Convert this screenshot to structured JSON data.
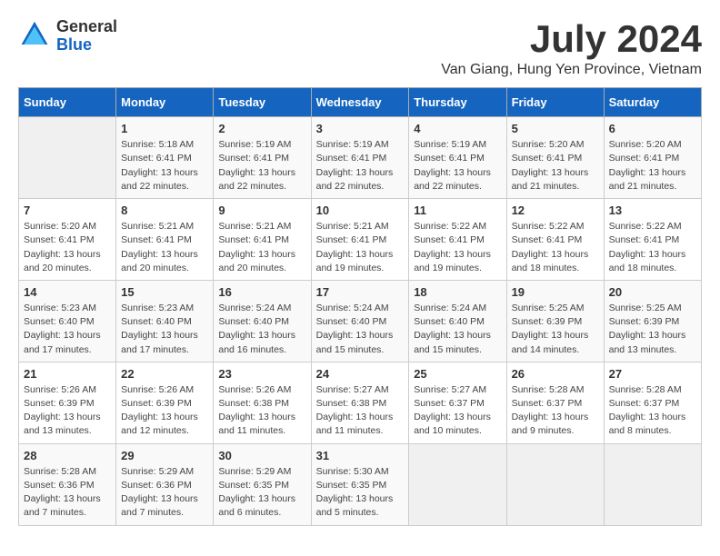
{
  "header": {
    "logo_line1": "General",
    "logo_line2": "Blue",
    "title": "July 2024",
    "subtitle": "Van Giang, Hung Yen Province, Vietnam"
  },
  "days_of_week": [
    "Sunday",
    "Monday",
    "Tuesday",
    "Wednesday",
    "Thursday",
    "Friday",
    "Saturday"
  ],
  "weeks": [
    [
      {
        "day": "",
        "info": ""
      },
      {
        "day": "1",
        "info": "Sunrise: 5:18 AM\nSunset: 6:41 PM\nDaylight: 13 hours\nand 22 minutes."
      },
      {
        "day": "2",
        "info": "Sunrise: 5:19 AM\nSunset: 6:41 PM\nDaylight: 13 hours\nand 22 minutes."
      },
      {
        "day": "3",
        "info": "Sunrise: 5:19 AM\nSunset: 6:41 PM\nDaylight: 13 hours\nand 22 minutes."
      },
      {
        "day": "4",
        "info": "Sunrise: 5:19 AM\nSunset: 6:41 PM\nDaylight: 13 hours\nand 22 minutes."
      },
      {
        "day": "5",
        "info": "Sunrise: 5:20 AM\nSunset: 6:41 PM\nDaylight: 13 hours\nand 21 minutes."
      },
      {
        "day": "6",
        "info": "Sunrise: 5:20 AM\nSunset: 6:41 PM\nDaylight: 13 hours\nand 21 minutes."
      }
    ],
    [
      {
        "day": "7",
        "info": "Sunrise: 5:20 AM\nSunset: 6:41 PM\nDaylight: 13 hours\nand 20 minutes."
      },
      {
        "day": "8",
        "info": "Sunrise: 5:21 AM\nSunset: 6:41 PM\nDaylight: 13 hours\nand 20 minutes."
      },
      {
        "day": "9",
        "info": "Sunrise: 5:21 AM\nSunset: 6:41 PM\nDaylight: 13 hours\nand 20 minutes."
      },
      {
        "day": "10",
        "info": "Sunrise: 5:21 AM\nSunset: 6:41 PM\nDaylight: 13 hours\nand 19 minutes."
      },
      {
        "day": "11",
        "info": "Sunrise: 5:22 AM\nSunset: 6:41 PM\nDaylight: 13 hours\nand 19 minutes."
      },
      {
        "day": "12",
        "info": "Sunrise: 5:22 AM\nSunset: 6:41 PM\nDaylight: 13 hours\nand 18 minutes."
      },
      {
        "day": "13",
        "info": "Sunrise: 5:22 AM\nSunset: 6:41 PM\nDaylight: 13 hours\nand 18 minutes."
      }
    ],
    [
      {
        "day": "14",
        "info": "Sunrise: 5:23 AM\nSunset: 6:40 PM\nDaylight: 13 hours\nand 17 minutes."
      },
      {
        "day": "15",
        "info": "Sunrise: 5:23 AM\nSunset: 6:40 PM\nDaylight: 13 hours\nand 17 minutes."
      },
      {
        "day": "16",
        "info": "Sunrise: 5:24 AM\nSunset: 6:40 PM\nDaylight: 13 hours\nand 16 minutes."
      },
      {
        "day": "17",
        "info": "Sunrise: 5:24 AM\nSunset: 6:40 PM\nDaylight: 13 hours\nand 15 minutes."
      },
      {
        "day": "18",
        "info": "Sunrise: 5:24 AM\nSunset: 6:40 PM\nDaylight: 13 hours\nand 15 minutes."
      },
      {
        "day": "19",
        "info": "Sunrise: 5:25 AM\nSunset: 6:39 PM\nDaylight: 13 hours\nand 14 minutes."
      },
      {
        "day": "20",
        "info": "Sunrise: 5:25 AM\nSunset: 6:39 PM\nDaylight: 13 hours\nand 13 minutes."
      }
    ],
    [
      {
        "day": "21",
        "info": "Sunrise: 5:26 AM\nSunset: 6:39 PM\nDaylight: 13 hours\nand 13 minutes."
      },
      {
        "day": "22",
        "info": "Sunrise: 5:26 AM\nSunset: 6:39 PM\nDaylight: 13 hours\nand 12 minutes."
      },
      {
        "day": "23",
        "info": "Sunrise: 5:26 AM\nSunset: 6:38 PM\nDaylight: 13 hours\nand 11 minutes."
      },
      {
        "day": "24",
        "info": "Sunrise: 5:27 AM\nSunset: 6:38 PM\nDaylight: 13 hours\nand 11 minutes."
      },
      {
        "day": "25",
        "info": "Sunrise: 5:27 AM\nSunset: 6:37 PM\nDaylight: 13 hours\nand 10 minutes."
      },
      {
        "day": "26",
        "info": "Sunrise: 5:28 AM\nSunset: 6:37 PM\nDaylight: 13 hours\nand 9 minutes."
      },
      {
        "day": "27",
        "info": "Sunrise: 5:28 AM\nSunset: 6:37 PM\nDaylight: 13 hours\nand 8 minutes."
      }
    ],
    [
      {
        "day": "28",
        "info": "Sunrise: 5:28 AM\nSunset: 6:36 PM\nDaylight: 13 hours\nand 7 minutes."
      },
      {
        "day": "29",
        "info": "Sunrise: 5:29 AM\nSunset: 6:36 PM\nDaylight: 13 hours\nand 7 minutes."
      },
      {
        "day": "30",
        "info": "Sunrise: 5:29 AM\nSunset: 6:35 PM\nDaylight: 13 hours\nand 6 minutes."
      },
      {
        "day": "31",
        "info": "Sunrise: 5:30 AM\nSunset: 6:35 PM\nDaylight: 13 hours\nand 5 minutes."
      },
      {
        "day": "",
        "info": ""
      },
      {
        "day": "",
        "info": ""
      },
      {
        "day": "",
        "info": ""
      }
    ]
  ]
}
